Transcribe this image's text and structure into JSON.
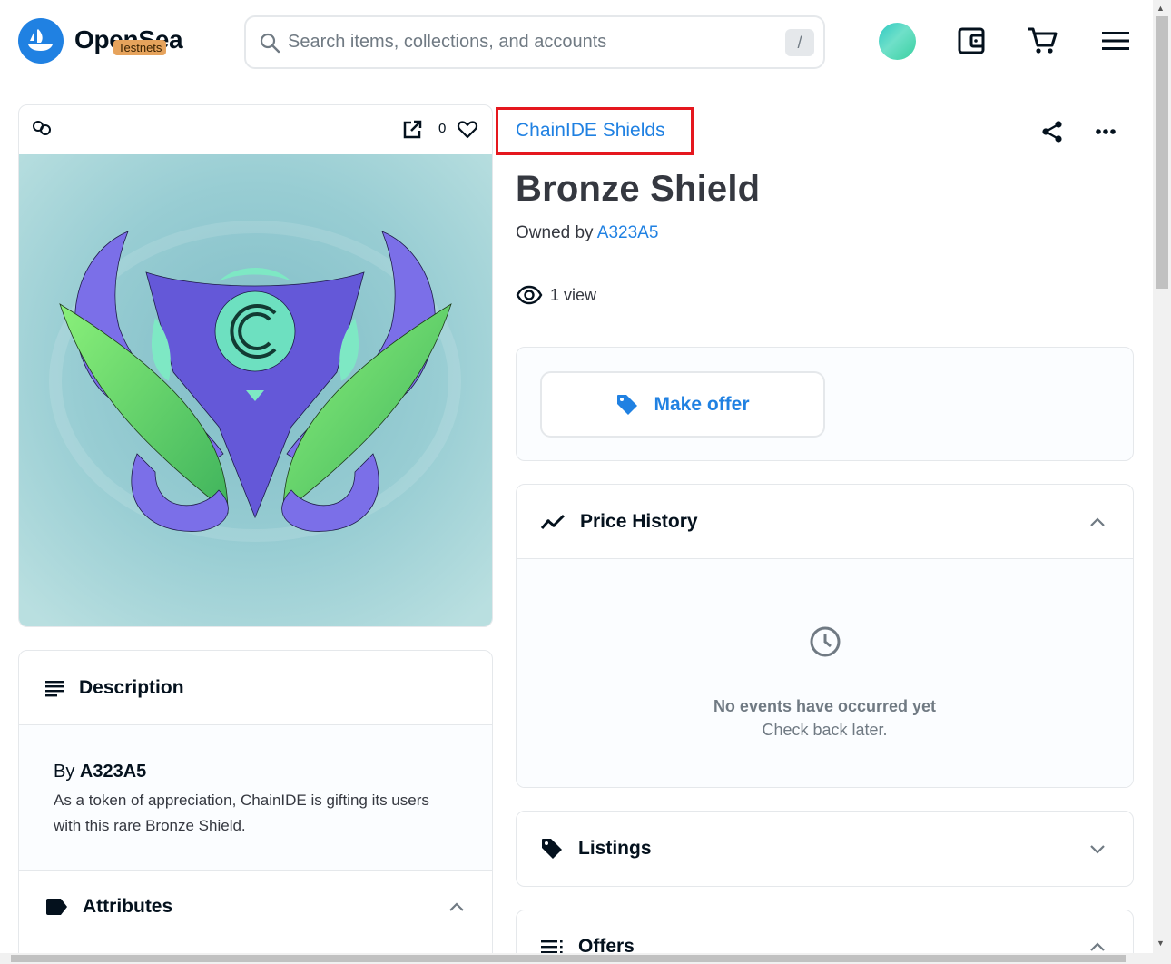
{
  "header": {
    "brand": "OpenSea",
    "badge": "Testnets",
    "search_placeholder": "Search items, collections, and accounts",
    "search_shortcut": "/"
  },
  "image_card": {
    "favorites_count": "0"
  },
  "item": {
    "collection": "ChainIDE Shields",
    "title": "Bronze Shield",
    "owned_by_label": "Owned by",
    "owner": "A323A5",
    "views": "1 view"
  },
  "description": {
    "title": "Description",
    "by_label": "By",
    "author": "A323A5",
    "text": "As a token of appreciation, ChainIDE is gifting its users with this rare Bronze Shield."
  },
  "attributes": {
    "title": "Attributes"
  },
  "actions": {
    "make_offer": "Make offer"
  },
  "price_history": {
    "title": "Price History",
    "empty_title": "No events have occurred yet",
    "empty_subtitle": "Check back later."
  },
  "listings": {
    "title": "Listings"
  },
  "offers": {
    "title": "Offers"
  },
  "colors": {
    "brand_blue": "#2081e2",
    "highlight_box": "#e5171e",
    "badge": "#e6a35c"
  }
}
